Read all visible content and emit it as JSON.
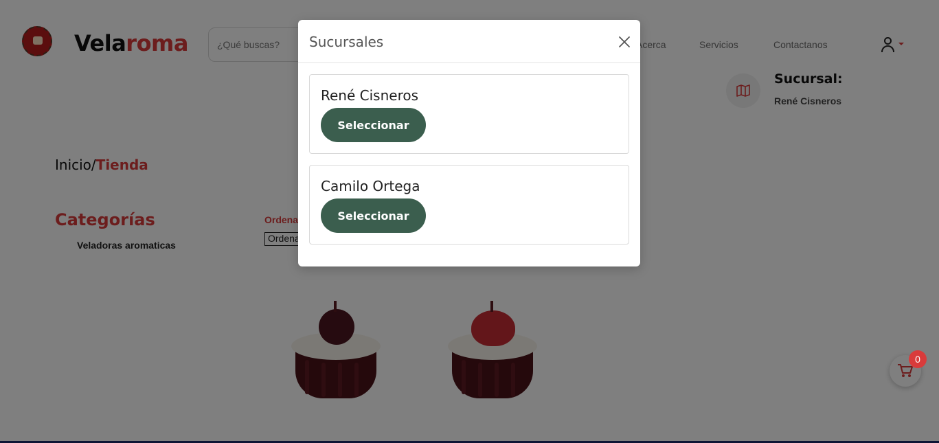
{
  "brand": {
    "part1": "Vela",
    "part2": "roma"
  },
  "search": {
    "placeholder": "¿Qué buscas?"
  },
  "nav": {
    "items": [
      "Acerca",
      "Servicios",
      "Contactanos"
    ]
  },
  "sucursal": {
    "label": "Sucursal:",
    "name": "René Cisneros"
  },
  "breadcrumb": {
    "home": "Inicio/",
    "current": "Tienda"
  },
  "categories": {
    "title": "Categorías",
    "items": [
      "Veladoras aromaticas"
    ]
  },
  "order": {
    "label": "Ordenar",
    "select_value": "Ordenar"
  },
  "cart": {
    "count": "0"
  },
  "modal": {
    "title": "Sucursales",
    "branches": [
      {
        "name": "René Cisneros",
        "button": "Seleccionar"
      },
      {
        "name": "Camilo Ortega",
        "button": "Seleccionar"
      }
    ]
  },
  "colors": {
    "accent": "#d93b3b",
    "button_green": "#3b5e4e"
  },
  "icons": [
    "logo-icon",
    "user-icon",
    "caret-down-icon",
    "map-icon",
    "cart-icon",
    "close-icon"
  ]
}
